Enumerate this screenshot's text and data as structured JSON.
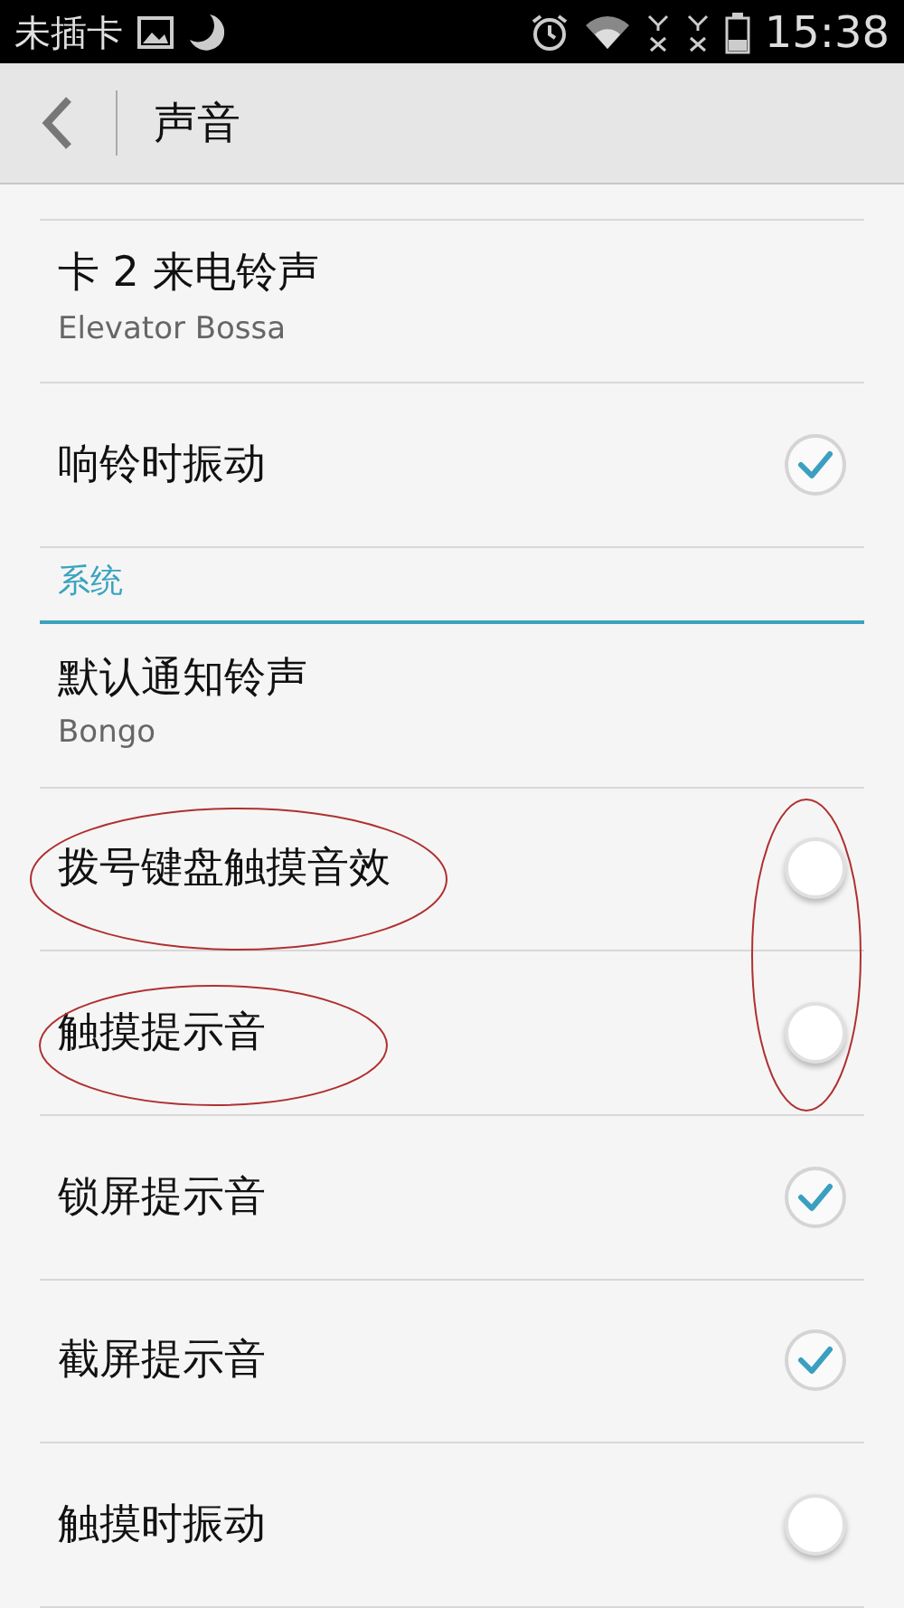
{
  "status_bar": {
    "carrier": "未插卡",
    "time": "15:38"
  },
  "header": {
    "title": "声音"
  },
  "list": [
    {
      "kind": "ringtone",
      "title": "卡 2 来电铃声",
      "subtitle": "Elevator Bossa"
    },
    {
      "kind": "checkbox",
      "title": "响铃时振动",
      "checked": true
    },
    {
      "kind": "section",
      "title": "系统"
    },
    {
      "kind": "ringtone",
      "title": "默认通知铃声",
      "subtitle": "Bongo"
    },
    {
      "kind": "checkbox",
      "title": "拨号键盘触摸音效",
      "checked": false
    },
    {
      "kind": "checkbox",
      "title": "触摸提示音",
      "checked": false
    },
    {
      "kind": "checkbox",
      "title": "锁屏提示音",
      "checked": true
    },
    {
      "kind": "checkbox",
      "title": "截屏提示音",
      "checked": true
    },
    {
      "kind": "checkbox",
      "title": "触摸时振动",
      "checked": false
    }
  ]
}
